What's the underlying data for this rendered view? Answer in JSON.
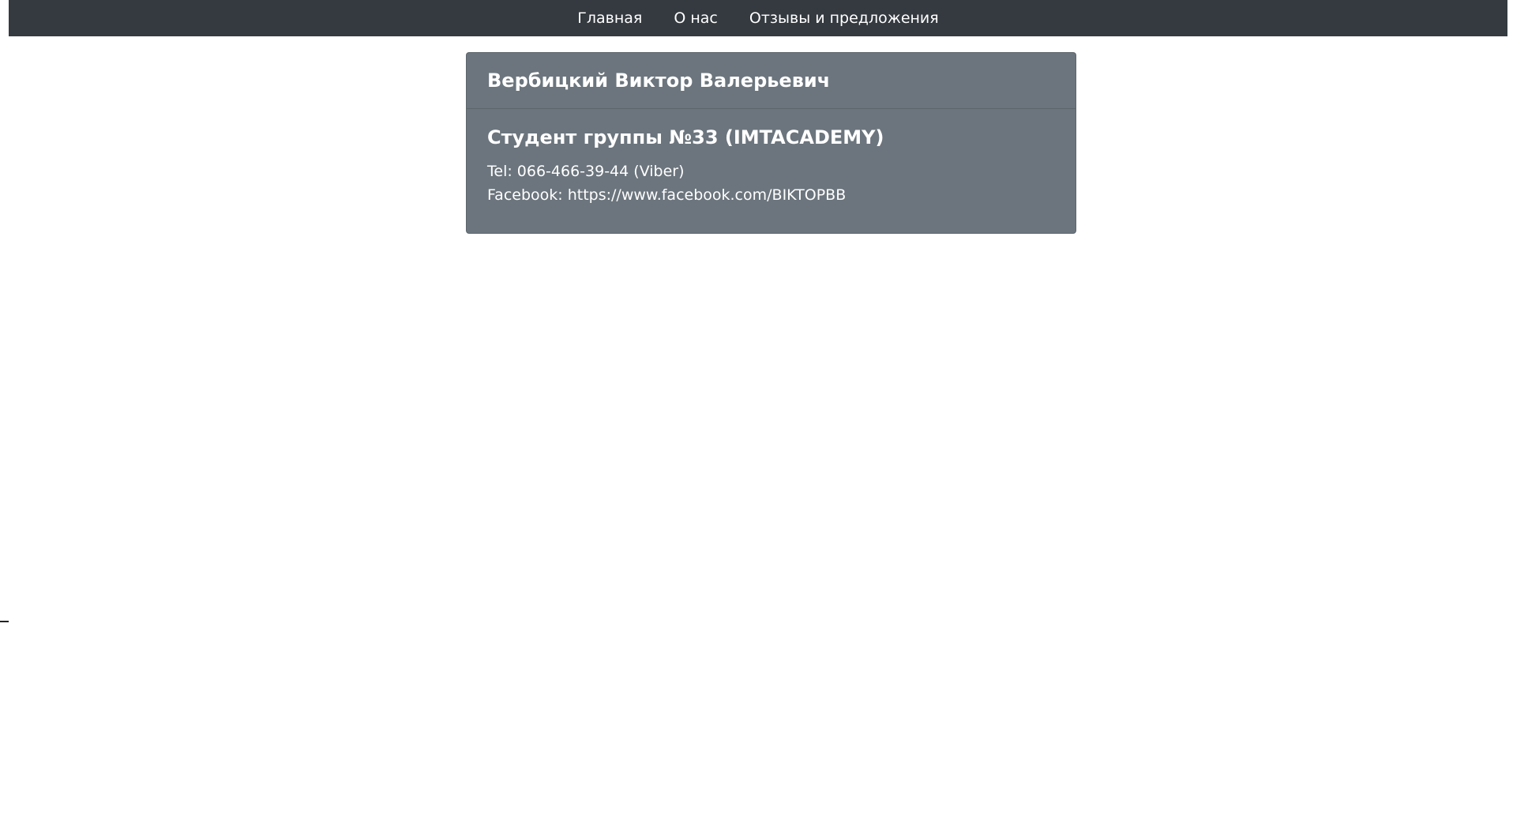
{
  "nav": {
    "items": [
      {
        "label": "Главная"
      },
      {
        "label": "О нас"
      },
      {
        "label": "Отзывы и предложения"
      }
    ]
  },
  "card": {
    "header": "Вербицкий Виктор Валерьевич",
    "subtitle": "Студент группы №33 (IMTACADEMY)",
    "tel": "Tel: 066-466-39-44 (Viber)",
    "facebook": "Facebook: https://www.facebook.com/BIKTOPBB"
  },
  "colors": {
    "navbar_bg": "#343a40",
    "card_bg": "#6c757d",
    "text": "#ffffff"
  }
}
